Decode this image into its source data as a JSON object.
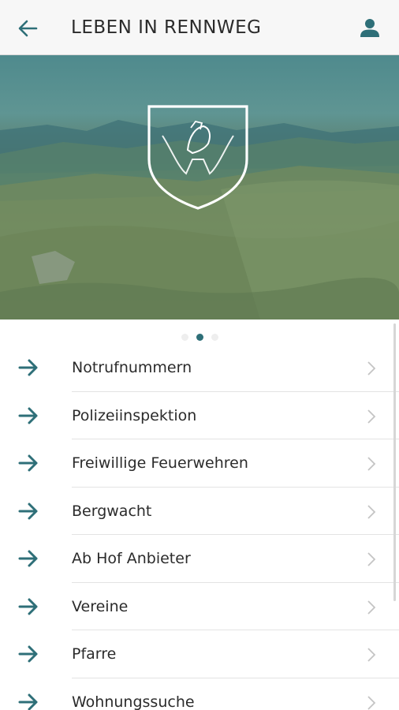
{
  "header": {
    "title": "LEBEN IN RENNWEG",
    "back_icon": "arrow-left-icon",
    "user_icon": "user-icon"
  },
  "carousel": {
    "slide_count": 3,
    "active_index": 1,
    "image": "mountain-landscape-with-coat-of-arms"
  },
  "colors": {
    "accent": "#2e6f78",
    "text": "#2b2b2b",
    "chevron": "#c4c4c4",
    "divider": "#e3e3e3"
  },
  "list": {
    "items": [
      {
        "label": "Notrufnummern"
      },
      {
        "label": "Polizeiinspektion"
      },
      {
        "label": "Freiwillige Feuerwehren"
      },
      {
        "label": "Bergwacht"
      },
      {
        "label": "Ab Hof Anbieter"
      },
      {
        "label": "Vereine"
      },
      {
        "label": "Pfarre"
      },
      {
        "label": "Wohnungssuche"
      }
    ]
  }
}
